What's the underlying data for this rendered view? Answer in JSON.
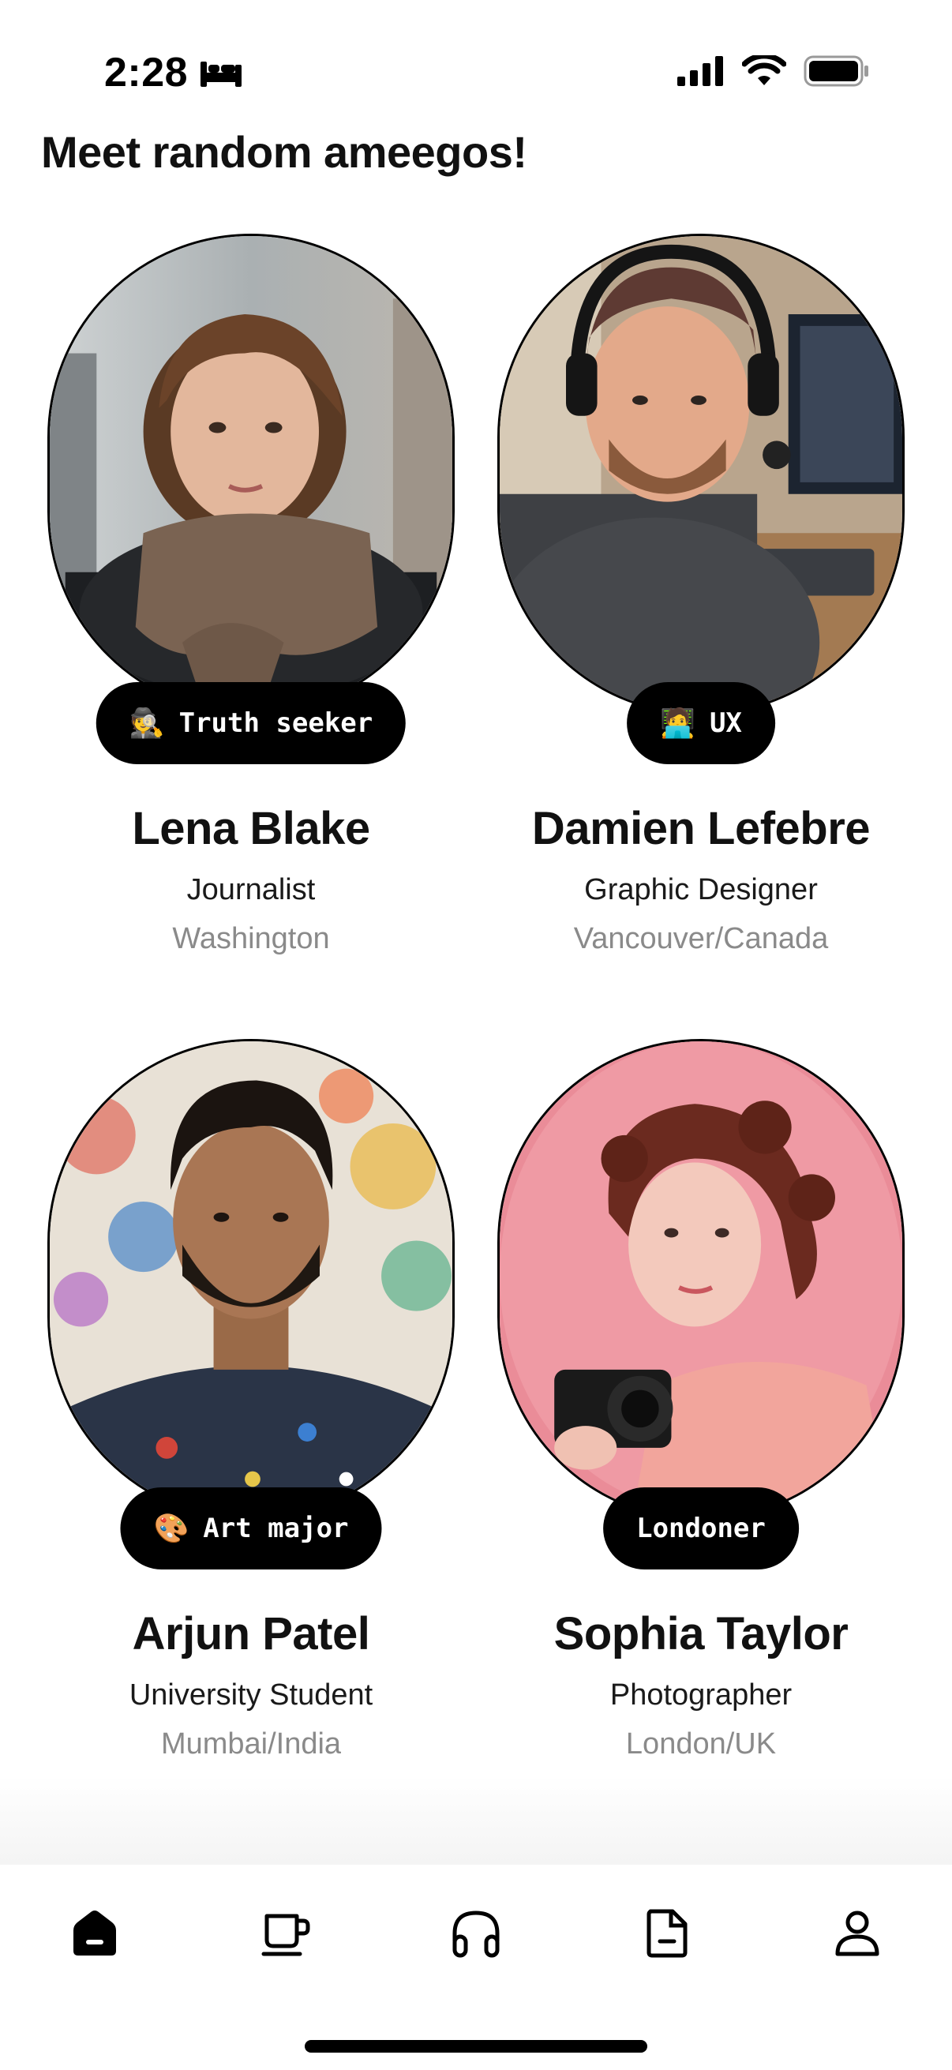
{
  "status_bar": {
    "time": "2:28",
    "icons": [
      "bed-icon",
      "cellular-signal-icon",
      "wifi-icon",
      "battery-icon"
    ]
  },
  "page": {
    "title": "Meet random ameegos!"
  },
  "profiles": [
    {
      "name": "Lena Blake",
      "role": "Journalist",
      "location": "Washington",
      "badge_emoji": "🕵️",
      "badge_label": "Truth seeker"
    },
    {
      "name": "Damien Lefebre",
      "role": "Graphic Designer",
      "location": "Vancouver/Canada",
      "badge_emoji": "🧑‍💻",
      "badge_label": "UX"
    },
    {
      "name": "Arjun Patel",
      "role": "University Student",
      "location": "Mumbai/India",
      "badge_emoji": "🎨",
      "badge_label": "Art major"
    },
    {
      "name": "Sophia Taylor",
      "role": "Photographer",
      "location": "London/UK",
      "badge_emoji": "",
      "badge_label": "Londoner"
    }
  ],
  "tab_bar": {
    "tabs": [
      "home-icon",
      "cup-icon",
      "headphones-icon",
      "document-icon",
      "profile-icon"
    ],
    "active": "home-icon"
  },
  "colors": {
    "background": "#ffffff",
    "badge_bg": "#000000",
    "secondary_text": "#8a8a8a"
  }
}
